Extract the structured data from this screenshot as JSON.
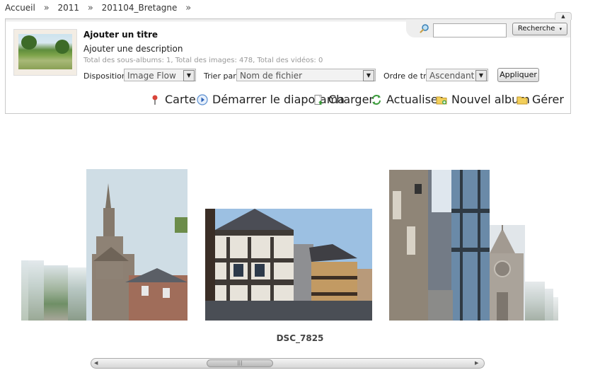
{
  "breadcrumb": {
    "items": [
      "Accueil",
      "2011",
      "201104_Bretagne"
    ],
    "separator": "»"
  },
  "album": {
    "title": "Ajouter un titre",
    "description": "Ajouter une description",
    "totals": "Total des sous-albums: 1, Total des images: 478, Total des vidéos: 0"
  },
  "search": {
    "button_label": "Recherche",
    "value": ""
  },
  "controls": {
    "layout_label": "Disposition",
    "layout_value": "Image Flow",
    "sort_label": "Trier par",
    "sort_value": "Nom de fichier",
    "order_label": "Ordre de tri",
    "order_value": "Ascendant",
    "apply_label": "Appliquer"
  },
  "actions": [
    {
      "label": "Carte",
      "icon": "map-pin-icon"
    },
    {
      "label": "Démarrer le diaporama",
      "icon": "play-icon"
    },
    {
      "label": "Charger",
      "icon": "upload-icon"
    },
    {
      "label": "Actualiser",
      "icon": "refresh-icon"
    },
    {
      "label": "Nouvel album",
      "icon": "new-folder-icon"
    },
    {
      "label": "Gérer",
      "icon": "folder-icon"
    }
  ],
  "flow": {
    "caption": "DSC_7825",
    "scroll_position": 0.35
  },
  "colors": {
    "accent": "#8f8f8f",
    "panel_border": "#c9c9c9"
  }
}
